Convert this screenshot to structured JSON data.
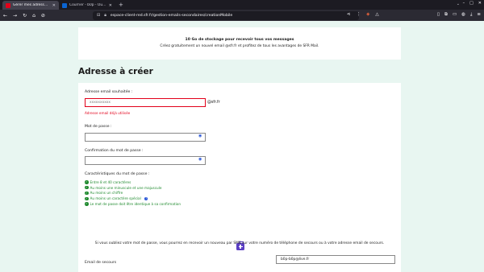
{
  "browser": {
    "tabs": [
      {
        "label": "Gérer mes adresses email",
        "active": true
      },
      {
        "label": "Courrier - b0p - Outlook",
        "active": false
      }
    ],
    "new_tab": "+",
    "url": "espace-client-red.sfr.fr/gestion-emails-secondaires/creationMobile",
    "window_controls": [
      "–",
      "□",
      "✕"
    ]
  },
  "promo": {
    "title": "10 Go de stockage pour recevoir tous vos messages",
    "text": "Créez gratuitement un nouvel email @sfr.fr et profitez de tous les avantages de SFR Mail."
  },
  "section_title": "Adresse à créer",
  "form": {
    "email_label": "Adresse email souhaitée :",
    "email_value": "xxxxxxxxxx",
    "email_domain": "@sfr.fr",
    "email_error": "Adresse email déjà utilisée",
    "password_label": "Mot de passe :",
    "confirm_label": "Confirmation du mot de passe :",
    "criteria_label": "Caractéristiques du mot de passe :",
    "criteria": [
      "Entre 8 et 40 caractères",
      "Au moins une minuscule et une majuscule",
      "Au moins un chiffre",
      "Au moins un caractère spécial",
      "Le mot de passe doit être identique à sa confirmation"
    ],
    "forgot_text": "Si vous oubliez votre mot de passe, vous pourrez en recevoir un nouveau par SMS sur votre numéro de téléphone de secours ou à votre adresse email de secours.",
    "backup_email_label": "Email de secours",
    "backup_email_value": "b0p-b0p@live.fr"
  },
  "colors": {
    "accent": "#1f4ed6",
    "error": "#e2001a",
    "success": "#1f8a2e",
    "background": "#e8f6f1",
    "icon_purple": "#5b3fc4"
  }
}
